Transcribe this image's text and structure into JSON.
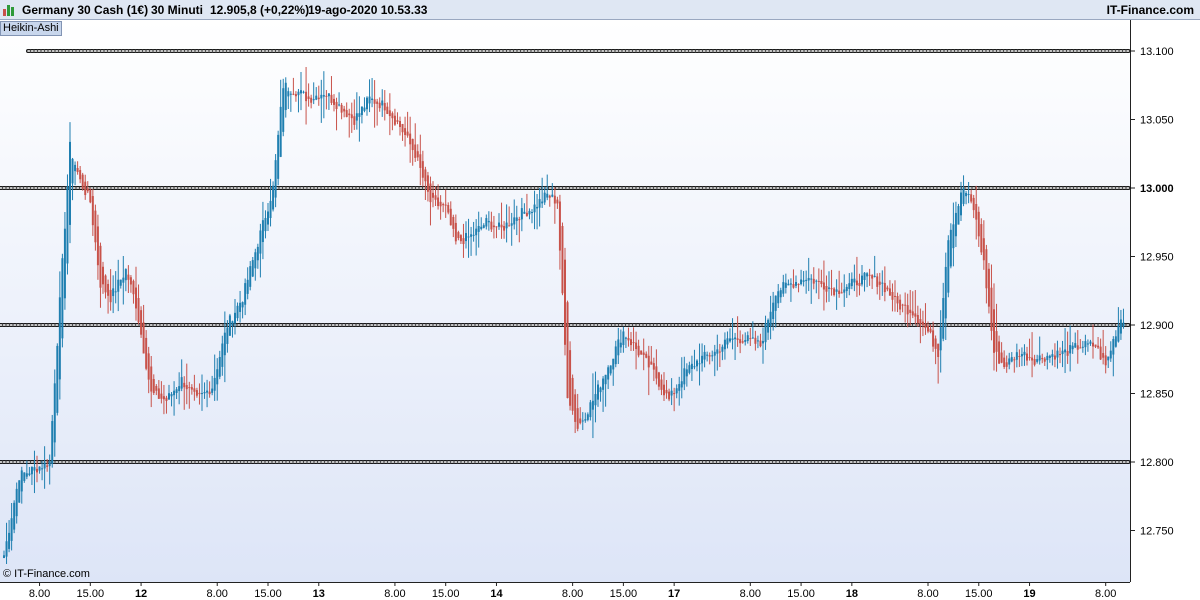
{
  "header": {
    "instrument": "Germany 30 Cash (1€)",
    "timeframe": "30 Minuti",
    "quote": "12.905,8 (+0,22%)",
    "datetime": "19-ago-2020 10.53.33",
    "brand": "IT-Finance.com"
  },
  "badge": "Heikin-Ashi",
  "footer": "© IT-Finance.com",
  "colors": {
    "bull": "#1f7fb0",
    "bear": "#c8524a",
    "background_top": "#ffffff",
    "background_bottom": "#dde5f7",
    "axis": "#222222"
  },
  "chart_data": {
    "type": "candlestick",
    "style": "Heikin-Ashi",
    "ylim": [
      12725,
      13120
    ],
    "y_ticks": [
      {
        "value": 13100,
        "label": "13.100",
        "bold": false
      },
      {
        "value": 13050,
        "label": "13.050",
        "bold": false
      },
      {
        "value": 13000,
        "label": "13.000",
        "bold": true
      },
      {
        "value": 12950,
        "label": "12.950",
        "bold": false
      },
      {
        "value": 12900,
        "label": "12.900",
        "bold": false
      },
      {
        "value": 12850,
        "label": "12.850",
        "bold": false
      },
      {
        "value": 12800,
        "label": "12.800",
        "bold": false
      },
      {
        "value": 12750,
        "label": "12.750",
        "bold": false
      }
    ],
    "x_ticks": [
      {
        "label": "8.00",
        "bold": false
      },
      {
        "label": "15.00",
        "bold": false
      },
      {
        "label": "12",
        "bold": true
      },
      {
        "label": "8.00",
        "bold": false
      },
      {
        "label": "15.00",
        "bold": false
      },
      {
        "label": "13",
        "bold": true
      },
      {
        "label": "8.00",
        "bold": false
      },
      {
        "label": "15.00",
        "bold": false
      },
      {
        "label": "14",
        "bold": true
      },
      {
        "label": "8.00",
        "bold": false
      },
      {
        "label": "15.00",
        "bold": false
      },
      {
        "label": "17",
        "bold": true
      },
      {
        "label": "8.00",
        "bold": false
      },
      {
        "label": "15.00",
        "bold": false
      },
      {
        "label": "18",
        "bold": true
      },
      {
        "label": "8.00",
        "bold": false
      },
      {
        "label": "15.00",
        "bold": false
      },
      {
        "label": "19",
        "bold": true
      },
      {
        "label": "8.00",
        "bold": false
      }
    ],
    "x_tick_bar_index": [
      14,
      34,
      54,
      84,
      104,
      124,
      154,
      174,
      194,
      224,
      244,
      264,
      294,
      314,
      334,
      364,
      384,
      404,
      434
    ],
    "levels": [
      13100,
      13000,
      12900,
      12800
    ],
    "path": [
      [
        0,
        12732
      ],
      [
        6,
        12790
      ],
      [
        12,
        12795
      ],
      [
        18,
        12800
      ],
      [
        20,
        12860
      ],
      [
        26,
        13030
      ],
      [
        30,
        13005
      ],
      [
        34,
        12990
      ],
      [
        38,
        12930
      ],
      [
        42,
        12920
      ],
      [
        48,
        12940
      ],
      [
        52,
        12915
      ],
      [
        58,
        12850
      ],
      [
        64,
        12845
      ],
      [
        70,
        12860
      ],
      [
        76,
        12845
      ],
      [
        82,
        12855
      ],
      [
        88,
        12900
      ],
      [
        94,
        12920
      ],
      [
        100,
        12960
      ],
      [
        106,
        13000
      ],
      [
        110,
        13075
      ],
      [
        116,
        13070
      ],
      [
        120,
        13065
      ],
      [
        126,
        13070
      ],
      [
        132,
        13060
      ],
      [
        138,
        13050
      ],
      [
        144,
        13065
      ],
      [
        150,
        13060
      ],
      [
        156,
        13045
      ],
      [
        162,
        13025
      ],
      [
        168,
        12990
      ],
      [
        174,
        12985
      ],
      [
        178,
        12960
      ],
      [
        184,
        12965
      ],
      [
        190,
        12975
      ],
      [
        196,
        12970
      ],
      [
        202,
        12980
      ],
      [
        208,
        12985
      ],
      [
        214,
        12995
      ],
      [
        218,
        12990
      ],
      [
        222,
        12850
      ],
      [
        226,
        12825
      ],
      [
        232,
        12845
      ],
      [
        238,
        12870
      ],
      [
        244,
        12895
      ],
      [
        250,
        12880
      ],
      [
        256,
        12865
      ],
      [
        262,
        12845
      ],
      [
        268,
        12865
      ],
      [
        274,
        12875
      ],
      [
        280,
        12880
      ],
      [
        286,
        12890
      ],
      [
        292,
        12890
      ],
      [
        298,
        12885
      ],
      [
        304,
        12925
      ],
      [
        310,
        12930
      ],
      [
        316,
        12935
      ],
      [
        322,
        12930
      ],
      [
        328,
        12925
      ],
      [
        334,
        12930
      ],
      [
        340,
        12935
      ],
      [
        346,
        12930
      ],
      [
        352,
        12915
      ],
      [
        358,
        12910
      ],
      [
        364,
        12895
      ],
      [
        368,
        12880
      ],
      [
        372,
        12965
      ],
      [
        378,
        13000
      ],
      [
        382,
        12985
      ],
      [
        386,
        12945
      ],
      [
        390,
        12880
      ],
      [
        394,
        12870
      ],
      [
        400,
        12880
      ],
      [
        406,
        12875
      ],
      [
        412,
        12878
      ],
      [
        418,
        12880
      ],
      [
        424,
        12885
      ],
      [
        430,
        12885
      ],
      [
        434,
        12870
      ],
      [
        438,
        12895
      ],
      [
        440,
        12905
      ]
    ]
  }
}
